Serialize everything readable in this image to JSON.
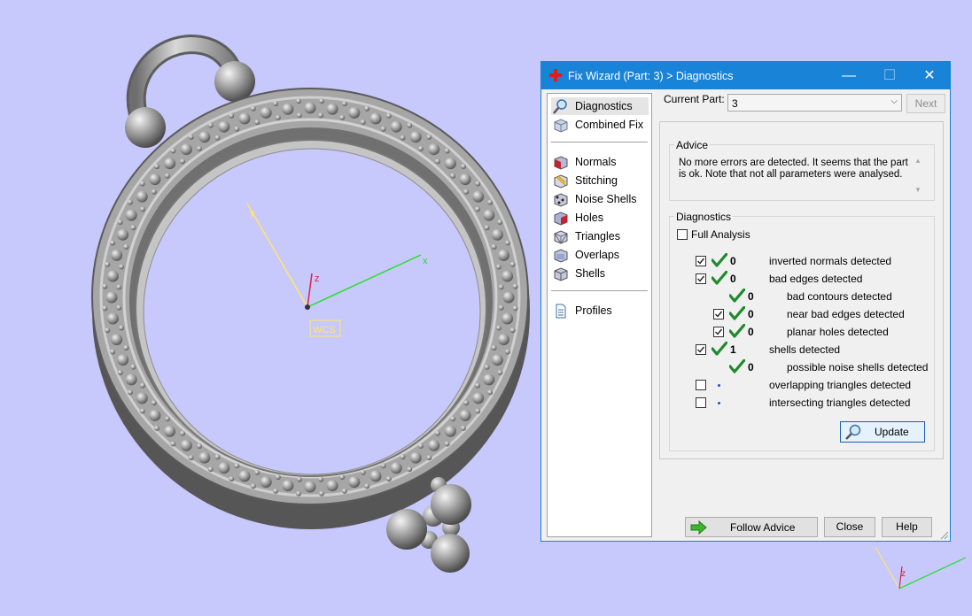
{
  "window": {
    "title": "Fix Wizard (Part: 3) > Diagnostics",
    "minimize": "—",
    "maximize": "☐",
    "close": "✕"
  },
  "nav": {
    "top": [
      {
        "label": "Diagnostics",
        "icon": "magnifier-icon",
        "selected": true
      },
      {
        "label": "Combined Fix",
        "icon": "cube-icon"
      }
    ],
    "tools": [
      {
        "label": "Normals",
        "icon": "normals-icon"
      },
      {
        "label": "Stitching",
        "icon": "stitching-icon"
      },
      {
        "label": "Noise Shells",
        "icon": "noise-shells-icon"
      },
      {
        "label": "Holes",
        "icon": "holes-icon"
      },
      {
        "label": "Triangles",
        "icon": "triangles-icon"
      },
      {
        "label": "Overlaps",
        "icon": "overlaps-icon"
      },
      {
        "label": "Shells",
        "icon": "shells-icon"
      }
    ],
    "profiles": {
      "label": "Profiles",
      "icon": "document-icon"
    }
  },
  "current_part": {
    "label": "Current Part:",
    "value": "3"
  },
  "buttons": {
    "next": "Next",
    "update": "Update",
    "follow_advice": "Follow Advice",
    "close": "Close",
    "help": "Help"
  },
  "advice": {
    "title": "Advice",
    "text": "No more errors are detected. It seems that the part is ok. Note that not all parameters were analysed."
  },
  "diagnostics": {
    "title": "Diagnostics",
    "full_analysis": {
      "label": "Full Analysis",
      "checked": false
    },
    "items": [
      {
        "checked": true,
        "status": "ok",
        "count": "0",
        "label": "inverted normals detected",
        "indent": 0
      },
      {
        "checked": true,
        "status": "ok",
        "count": "0",
        "label": "bad edges detected",
        "indent": 0
      },
      {
        "checked": null,
        "status": "ok",
        "count": "0",
        "label": "bad contours detected",
        "indent": 1
      },
      {
        "checked": true,
        "status": "ok",
        "count": "0",
        "label": "near bad edges detected",
        "indent": 1
      },
      {
        "checked": true,
        "status": "ok",
        "count": "0",
        "label": "planar holes detected",
        "indent": 1
      },
      {
        "checked": true,
        "status": "ok",
        "count": "1",
        "label": "shells detected",
        "indent": 0
      },
      {
        "checked": null,
        "status": "ok",
        "count": "0",
        "label": "possible noise shells detected",
        "indent": 1
      },
      {
        "checked": false,
        "status": "pending",
        "count": "",
        "label": "overlapping triangles detected",
        "indent": 0
      },
      {
        "checked": false,
        "status": "pending",
        "count": "",
        "label": "intersecting triangles detected",
        "indent": 0
      }
    ]
  },
  "scene": {
    "axes": {
      "x": "x",
      "y": "y",
      "z": "z"
    },
    "wcs_label": "WCS",
    "background": "#c7c8fb",
    "accent": "#1883d7"
  }
}
